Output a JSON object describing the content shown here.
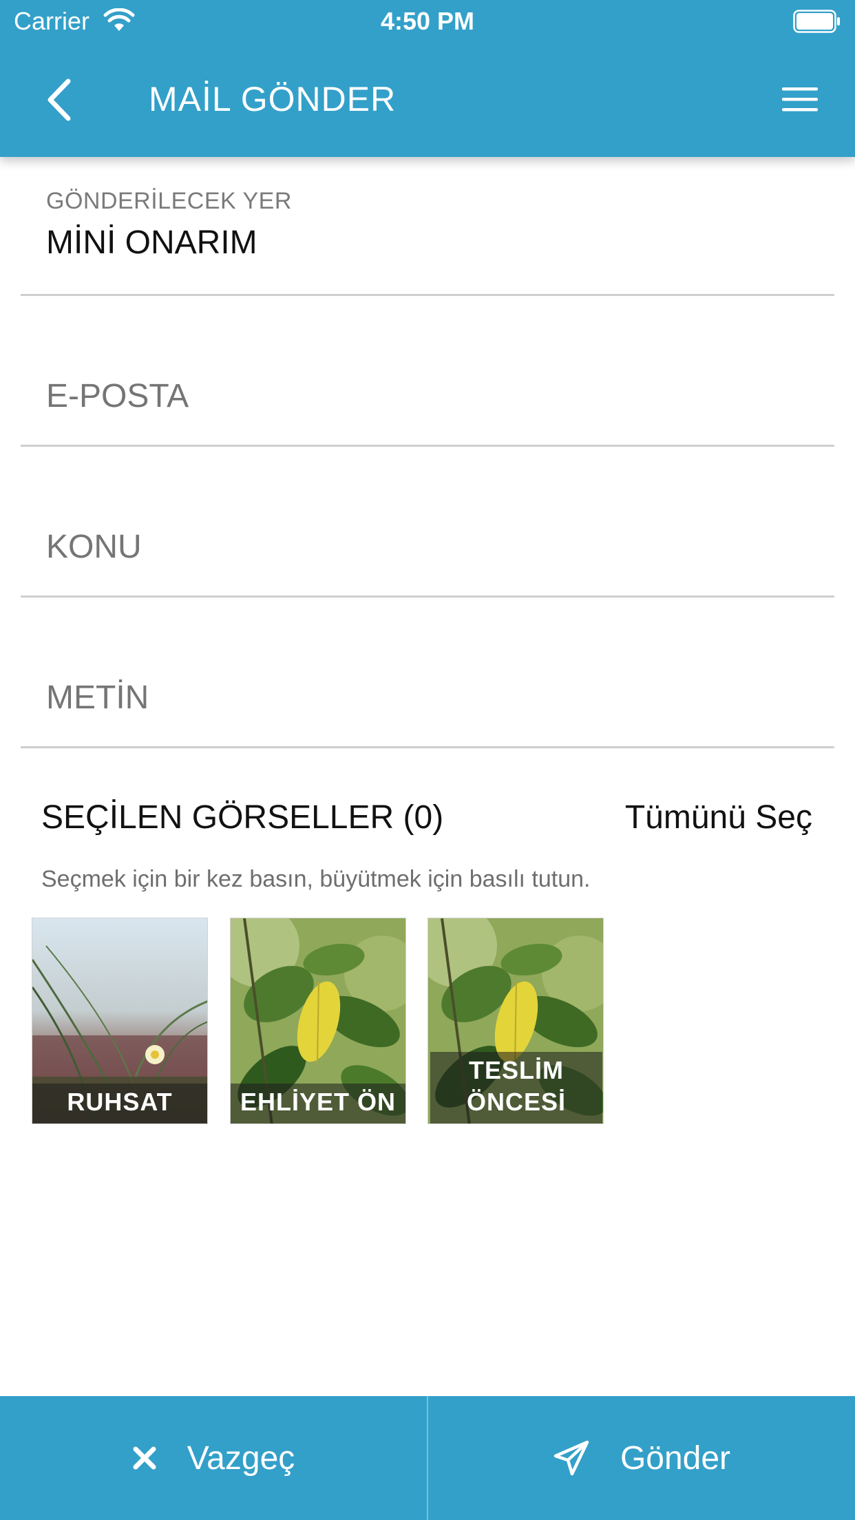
{
  "status_bar": {
    "carrier": "Carrier",
    "time": "4:50 PM"
  },
  "nav": {
    "title": "MAİL GÖNDER",
    "back_icon": "chevron-left-icon",
    "menu_icon": "hamburger-menu-icon"
  },
  "form": {
    "recipient": {
      "label": "GÖNDERİLECEK YER",
      "value": "MİNİ ONARIM"
    },
    "email": {
      "placeholder": "E-POSTA"
    },
    "subject": {
      "placeholder": "KONU"
    },
    "body": {
      "placeholder": "METİN"
    }
  },
  "gallery": {
    "title": "SEÇİLEN GÖRSELLER (0)",
    "select_all": "Tümünü Seç",
    "hint": "Seçmek için bir kez basın, büyütmek için basılı tutun.",
    "items": [
      {
        "caption": "RUHSAT"
      },
      {
        "caption": "EHLİYET ÖN"
      },
      {
        "caption": "TESLİM\nÖNCESİ"
      }
    ]
  },
  "actions": {
    "cancel_label": "Vazgeç",
    "cancel_icon": "close-icon",
    "send_label": "Gönder",
    "send_icon": "paper-plane-icon"
  },
  "colors": {
    "primary": "#33a0c9",
    "divider": "#cfcfcf",
    "placeholder": "#7d7d7d"
  }
}
